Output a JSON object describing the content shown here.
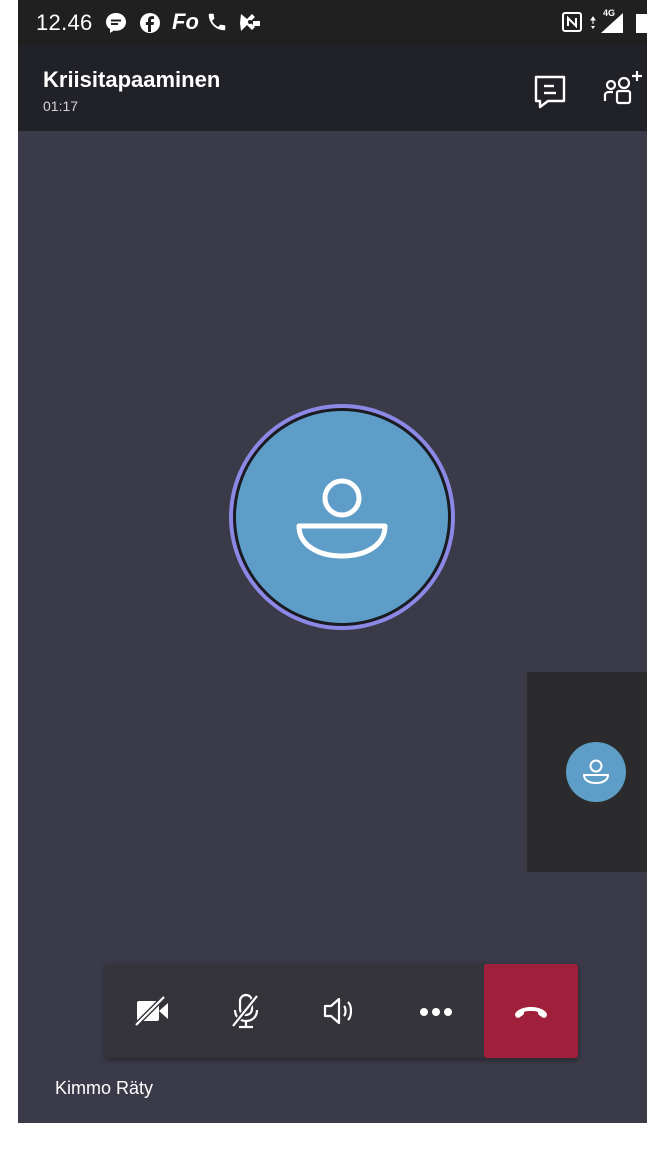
{
  "status_bar": {
    "time": "12.46",
    "carrier_app_label": "Fo",
    "network_label": "4G",
    "icons": [
      "messenger-icon",
      "facebook-icon",
      "phone-call-icon",
      "app-notification-icon",
      "nfc-icon",
      "signal-icon",
      "battery-icon"
    ]
  },
  "call": {
    "title": "Kriisitapaaminen",
    "duration": "01:17",
    "participant_name": "Kimmo Räty"
  },
  "header_actions": [
    "chat-icon",
    "add-participant-icon"
  ],
  "controls": [
    {
      "name": "video-off",
      "icon": "video-off-icon"
    },
    {
      "name": "mute",
      "icon": "mic-off-icon"
    },
    {
      "name": "speaker",
      "icon": "speaker-icon"
    },
    {
      "name": "more",
      "icon": "more-icon"
    },
    {
      "name": "hang-up",
      "icon": "hang-up-icon"
    }
  ],
  "colors": {
    "stage_background": "#3a3a48",
    "header_background": "#212128",
    "avatar_fill": "#5e9dc8",
    "speaking_ring": "#8c88e6",
    "hangup": "#a01f3a",
    "control_bar": "#34343a"
  }
}
